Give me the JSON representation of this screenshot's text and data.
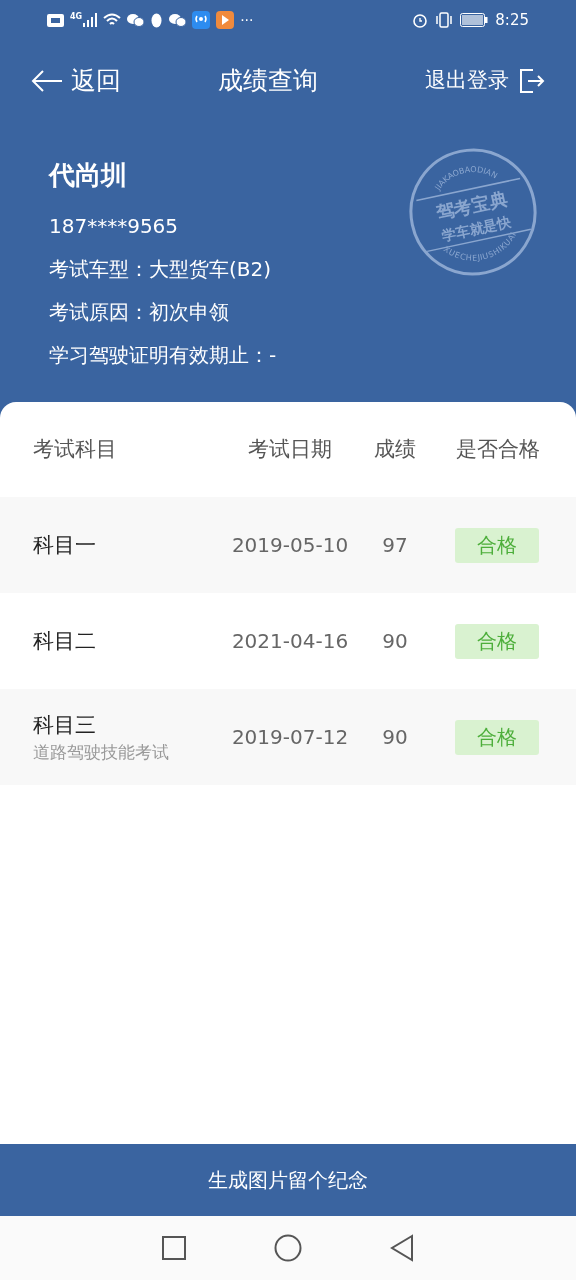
{
  "status_bar": {
    "network": "4G",
    "more": "···",
    "time": "8:25"
  },
  "nav": {
    "back": "返回",
    "title": "成绩查询",
    "logout": "退出登录"
  },
  "profile": {
    "name": "代尚圳",
    "phone": "187****9565",
    "lines": [
      "考试车型：大型货车(B2)",
      "考试原因：初次申领",
      "学习驾驶证明有效期止：-"
    ]
  },
  "stamp": {
    "top_arc": "JIAKAOBAODIAN",
    "line_1": "驾考宝典",
    "line_2": "学车就是快",
    "bottom_arc": "XUECHEJIUSHIKUAI"
  },
  "table": {
    "columns": [
      "考试科目",
      "考试日期",
      "成绩",
      "是否合格"
    ],
    "rows": [
      {
        "subject": "科目一",
        "date": "2019-05-10",
        "score": "97",
        "result": "合格",
        "passed": true
      },
      {
        "subject": "科目二",
        "date": "2021-04-16",
        "score": "90",
        "result": "合格",
        "passed": true
      },
      {
        "subject": "科目三",
        "note": "道路驾驶技能考试",
        "date": "2019-07-12",
        "score": "90",
        "result": "合格",
        "passed": true
      }
    ]
  },
  "bottom_button": "生成图片留个纪念"
}
